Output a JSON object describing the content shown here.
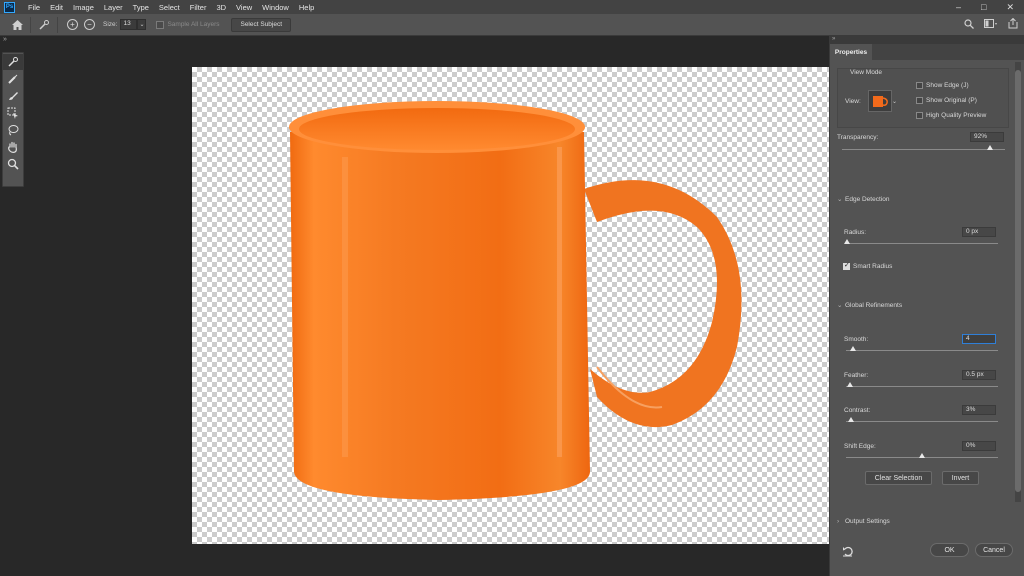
{
  "app": {
    "logo_text": "Ps"
  },
  "menu": {
    "items": [
      "File",
      "Edit",
      "Image",
      "Layer",
      "Type",
      "Select",
      "Filter",
      "3D",
      "View",
      "Window",
      "Help"
    ]
  },
  "options_bar": {
    "size_label": "Size:",
    "size_value": "13",
    "sample_all_layers_label": "Sample All Layers",
    "select_subject_label": "Select Subject"
  },
  "tools": [
    "quick-selection-brush",
    "refine-edge-brush",
    "brush",
    "object-selection",
    "lasso",
    "hand",
    "zoom"
  ],
  "panel": {
    "tab_label": "Properties",
    "view_mode": {
      "heading": "View Mode",
      "view_label": "View:",
      "show_edge_label": "Show Edge (J)",
      "show_original_label": "Show Original (P)",
      "hq_preview_label": "High Quality Preview"
    },
    "transparency": {
      "label": "Transparency:",
      "value": "92%",
      "level": 0.92
    },
    "edge_detection": {
      "heading": "Edge Detection",
      "radius_label": "Radius:",
      "radius_value": "0 px",
      "smart_radius_label": "Smart Radius",
      "smart_radius_checked": true
    },
    "global_refinements": {
      "heading": "Global Refinements",
      "smooth_label": "Smooth:",
      "smooth_value": "4",
      "feather_label": "Feather:",
      "feather_value": "0.5 px",
      "contrast_label": "Contrast:",
      "contrast_value": "3%",
      "shift_edge_label": "Shift Edge:",
      "shift_edge_value": "0%"
    },
    "clear_selection_label": "Clear Selection",
    "invert_label": "Invert",
    "output_settings_heading": "Output Settings",
    "ok_label": "OK",
    "cancel_label": "Cancel"
  },
  "colors": {
    "mug_orange": "#f26a1b",
    "checker_light": "#ffffff",
    "checker_dark": "#cccccc",
    "panel_bg": "#535353",
    "accent_blue": "#2f7fd8"
  }
}
